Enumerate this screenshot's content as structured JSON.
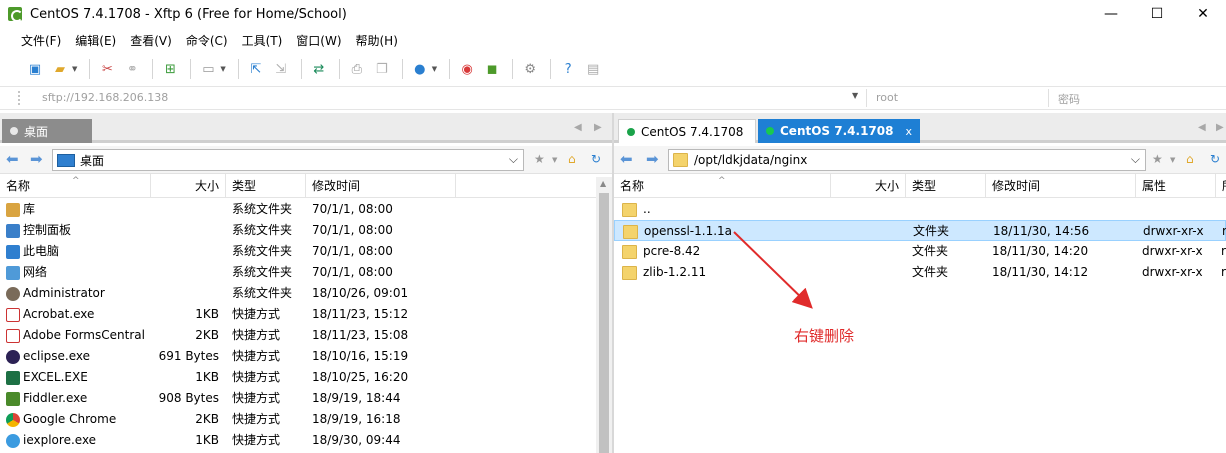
{
  "window": {
    "title": "CentOS 7.4.1708 - Xftp 6 (Free for Home/School)",
    "minimize": "—",
    "maximize": "☐",
    "close": "✕"
  },
  "menu": [
    "文件(F)",
    "编辑(E)",
    "查看(V)",
    "命令(C)",
    "工具(T)",
    "窗口(W)",
    "帮助(H)"
  ],
  "address": {
    "host": "sftp://192.168.206.138",
    "user": "root",
    "password_placeholder": "密码"
  },
  "left": {
    "tab": "桌面",
    "path": "桌面",
    "columns": {
      "name": "名称",
      "size": "大小",
      "type": "类型",
      "modified": "修改时间"
    },
    "rows": [
      {
        "name": "库",
        "size": "",
        "type": "系统文件夹",
        "modified": "70/1/1, 08:00",
        "icon": "library-icon"
      },
      {
        "name": "控制面板",
        "size": "",
        "type": "系统文件夹",
        "modified": "70/1/1, 08:00",
        "icon": "control-panel-icon"
      },
      {
        "name": "此电脑",
        "size": "",
        "type": "系统文件夹",
        "modified": "70/1/1, 08:00",
        "icon": "computer-icon"
      },
      {
        "name": "网络",
        "size": "",
        "type": "系统文件夹",
        "modified": "70/1/1, 08:00",
        "icon": "network-icon"
      },
      {
        "name": "Administrator",
        "size": "",
        "type": "系统文件夹",
        "modified": "18/10/26, 09:01",
        "icon": "user-icon"
      },
      {
        "name": "Acrobat.exe",
        "size": "1KB",
        "type": "快捷方式",
        "modified": "18/11/23, 15:12",
        "icon": "acrobat-icon"
      },
      {
        "name": "Adobe FormsCentral",
        "size": "2KB",
        "type": "快捷方式",
        "modified": "18/11/23, 15:08",
        "icon": "adobe-icon"
      },
      {
        "name": "eclipse.exe",
        "size": "691 Bytes",
        "type": "快捷方式",
        "modified": "18/10/16, 15:19",
        "icon": "eclipse-icon"
      },
      {
        "name": "EXCEL.EXE",
        "size": "1KB",
        "type": "快捷方式",
        "modified": "18/10/25, 16:20",
        "icon": "excel-icon"
      },
      {
        "name": "Fiddler.exe",
        "size": "908 Bytes",
        "type": "快捷方式",
        "modified": "18/9/19, 18:44",
        "icon": "fiddler-icon"
      },
      {
        "name": "Google Chrome",
        "size": "2KB",
        "type": "快捷方式",
        "modified": "18/9/19, 16:18",
        "icon": "chrome-icon"
      },
      {
        "name": "iexplore.exe",
        "size": "1KB",
        "type": "快捷方式",
        "modified": "18/9/30, 09:44",
        "icon": "ie-icon"
      }
    ]
  },
  "right": {
    "tabs": [
      "CentOS 7.4.1708",
      "CentOS 7.4.1708"
    ],
    "tab_close": "x",
    "path": "/opt/ldkjdata/nginx",
    "columns": {
      "name": "名称",
      "size": "大小",
      "type": "类型",
      "modified": "修改时间",
      "attr": "属性",
      "owner": "所"
    },
    "rows": [
      {
        "name": "..",
        "size": "",
        "type": "",
        "modified": "",
        "attr": "",
        "owner": ""
      },
      {
        "name": "openssl-1.1.1a",
        "size": "",
        "type": "文件夹",
        "modified": "18/11/30, 14:56",
        "attr": "drwxr-xr-x",
        "owner": "r"
      },
      {
        "name": "pcre-8.42",
        "size": "",
        "type": "文件夹",
        "modified": "18/11/30, 14:20",
        "attr": "drwxr-xr-x",
        "owner": "r"
      },
      {
        "name": "zlib-1.2.11",
        "size": "",
        "type": "文件夹",
        "modified": "18/11/30, 14:12",
        "attr": "drwxr-xr-x",
        "owner": "r"
      }
    ]
  },
  "annotation": "右键删除",
  "colors": {
    "accent": "#1e7fd4",
    "selection": "#cde8ff",
    "annotation": "#e02b2b",
    "online": "#1aa34a"
  }
}
